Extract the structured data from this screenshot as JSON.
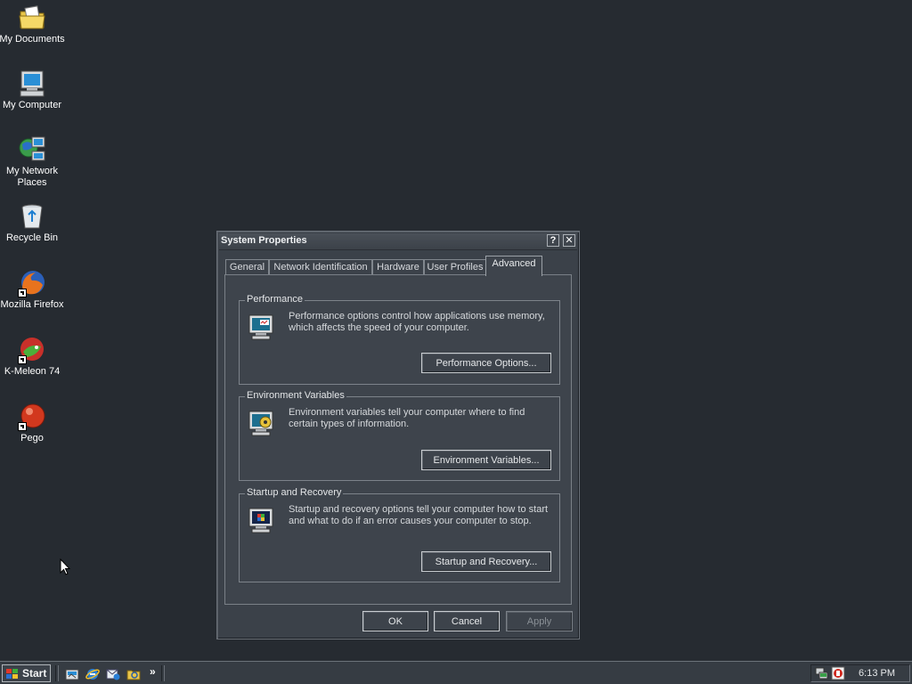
{
  "desktop": {
    "icons": [
      {
        "label": "My Documents",
        "icon": "folder-documents-icon"
      },
      {
        "label": "My Computer",
        "icon": "computer-icon"
      },
      {
        "label": "My Network Places",
        "icon": "network-places-icon"
      },
      {
        "label": "Recycle Bin",
        "icon": "recycle-bin-icon"
      },
      {
        "label": "Mozilla Firefox",
        "icon": "firefox-icon"
      },
      {
        "label": "K-Meleon 74",
        "icon": "k-meleon-icon"
      },
      {
        "label": "Pego",
        "icon": "pego-icon"
      }
    ]
  },
  "dialog": {
    "title": "System Properties",
    "help_button": "?",
    "close_button": "✕",
    "tabs": [
      {
        "label": "General",
        "active": false
      },
      {
        "label": "Network Identification",
        "active": false
      },
      {
        "label": "Hardware",
        "active": false
      },
      {
        "label": "User Profiles",
        "active": false
      },
      {
        "label": "Advanced",
        "active": true
      }
    ],
    "groups": [
      {
        "legend": "Performance",
        "description": "Performance options control how applications use memory, which affects the speed of your computer.",
        "button": "Performance Options...",
        "icon": "performance-monitor-icon"
      },
      {
        "legend": "Environment Variables",
        "description": "Environment variables tell your computer where to find certain types of information.",
        "button": "Environment Variables...",
        "icon": "environment-monitor-icon"
      },
      {
        "legend": "Startup and Recovery",
        "description": "Startup and recovery options tell your computer how to start and what to do if an error causes your computer to stop.",
        "button": "Startup and Recovery...",
        "icon": "startup-monitor-icon"
      }
    ],
    "ok_button": "OK",
    "cancel_button": "Cancel",
    "apply_button": "Apply"
  },
  "taskbar": {
    "start_label": "Start",
    "quick_launch": [
      "show-desktop-icon",
      "internet-explorer-icon",
      "outlook-express-icon",
      "explorer-icon"
    ],
    "overflow": "»",
    "tray_icons": [
      "network-tray-icon",
      "antivirus-tray-icon"
    ],
    "clock": "6:13 PM"
  },
  "colors": {
    "desktop_background": "#262b31",
    "dialog_background": "#3b4149",
    "taskbar_background": "#363c43"
  }
}
